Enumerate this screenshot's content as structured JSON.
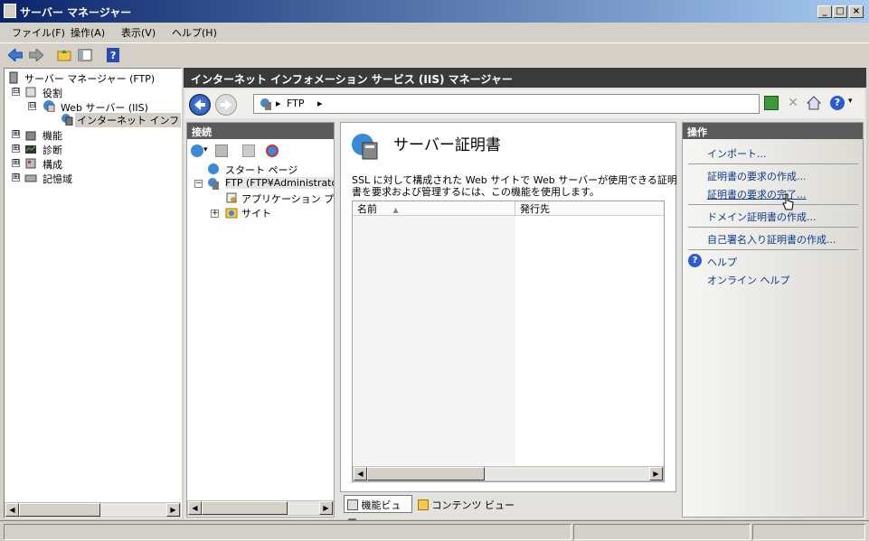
{
  "window": {
    "title": "サーバー マネージャー"
  },
  "menu": {
    "items": [
      "ファイル(F)",
      "操作(A)",
      "表示(V)",
      "ヘルプ(H)"
    ]
  },
  "toolbar": {
    "icons": [
      "back-arrow-icon",
      "forward-arrow-icon",
      "folder-up-icon",
      "show-hide-console-tree-icon",
      "help-icon"
    ]
  },
  "left_tree": {
    "root": "サーバー マネージャー (FTP)",
    "items": [
      {
        "label": "役割",
        "expander": "⊟"
      },
      {
        "label": "Web サーバー (IIS)",
        "expander": "⊟"
      },
      {
        "label": "インターネット インフォメ",
        "selected": true
      },
      {
        "label": "機能",
        "expander": "⊞"
      },
      {
        "label": "診断",
        "expander": "⊞"
      },
      {
        "label": "構成",
        "expander": "⊞"
      },
      {
        "label": "記憶域",
        "expander": "⊞"
      }
    ]
  },
  "iis": {
    "header": "インターネット インフォメーション サービス (IIS) マネージャー",
    "address": {
      "segments": [
        "FTP"
      ]
    }
  },
  "connections": {
    "title": "接続",
    "tree": [
      {
        "label": "スタート ページ"
      },
      {
        "label": "FTP (FTP¥Administrato"
      },
      {
        "label": "アプリケーション プール"
      },
      {
        "label": "サイト"
      }
    ]
  },
  "center": {
    "heading": "サーバー証明書",
    "description_line1": "SSL に対して構成された Web サイトで Web サーバーが使用できる証明",
    "description_line2": "書を要求および管理するには、この機能を使用します。",
    "columns": [
      "名前",
      "発行先"
    ],
    "view_tabs": [
      "機能ビュー",
      "コンテンツ ビュー"
    ]
  },
  "actions": {
    "title": "操作",
    "items": [
      "インポート...",
      "証明書の要求の作成...",
      "証明書の要求の完了...",
      "ドメイン証明書の作成...",
      "自己署名入り証明書の作成...",
      "ヘルプ",
      "オンライン ヘルプ"
    ]
  }
}
